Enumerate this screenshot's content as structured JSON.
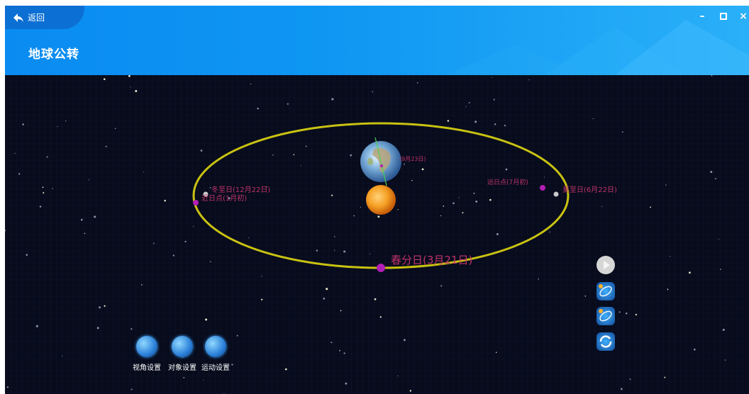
{
  "header": {
    "back_label": "返回",
    "title": "地球公转",
    "window_controls": [
      "minimize-icon",
      "maximize-icon",
      "close-icon"
    ]
  },
  "orbit": {
    "labels": {
      "spring_equinox": "春分日(3月21日)",
      "autumn_equinox": "(9月23日)",
      "winter_solstice": "冬至日(12月22日)",
      "perihelion": "近日点(1月初)",
      "aphelion": "远日点(7月初)",
      "summer_solstice": "夏至日(6月22日)"
    }
  },
  "toolbar": {
    "view_settings": "视角设置",
    "object_settings": "对象设置",
    "motion_settings": "运动设置"
  },
  "controls": [
    "play-icon",
    "orbit-view-icon",
    "orbit-zoom-icon",
    "rotate-icon"
  ],
  "colors": {
    "header_blue": "#0a8bf1",
    "space": "#070b1c",
    "orbit": "#c9c212",
    "label": "#c0336a",
    "marker": "#b01fb5"
  }
}
